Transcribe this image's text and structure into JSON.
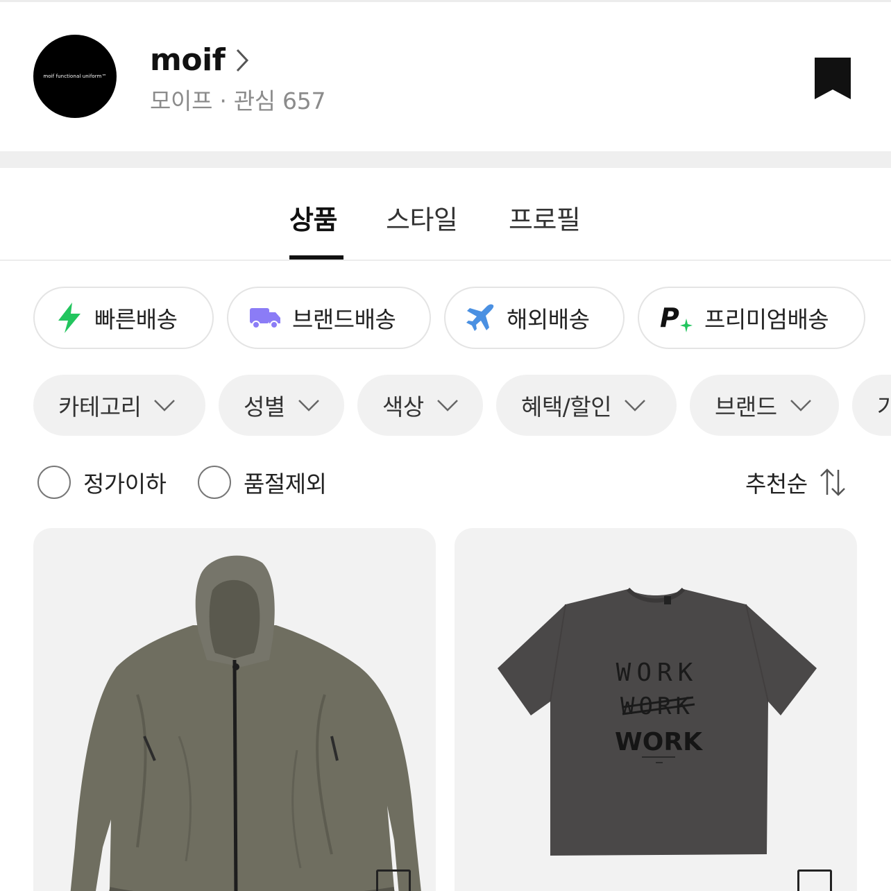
{
  "brand": {
    "logo_text": "moif functional uniform™",
    "name": "moif",
    "subtitle": "모이프 · 관심 657"
  },
  "tabs": [
    {
      "label": "상품",
      "active": true
    },
    {
      "label": "스타일",
      "active": false
    },
    {
      "label": "프로필",
      "active": false
    }
  ],
  "shipping_filters": [
    {
      "label": "빠른배송",
      "icon": "lightning-icon",
      "color": "#22c55e"
    },
    {
      "label": "브랜드배송",
      "icon": "truck-icon",
      "color": "#8b7cf6"
    },
    {
      "label": "해외배송",
      "icon": "airplane-icon",
      "color": "#4a90e2"
    },
    {
      "label": "프리미엄배송",
      "icon": "premium-p-icon",
      "color": "#22c55e"
    }
  ],
  "filters": [
    {
      "label": "카테고리"
    },
    {
      "label": "성별"
    },
    {
      "label": "색상"
    },
    {
      "label": "혜택/할인"
    },
    {
      "label": "브랜드"
    },
    {
      "label": "가"
    }
  ],
  "options": {
    "below_retail": "정가이하",
    "exclude_sold_out": "품절제외",
    "sort": "추천순"
  },
  "products": [
    {
      "image": "olive hooded zip-up windbreaker jacket",
      "color": "#6f6e60"
    },
    {
      "image": "charcoal short sleeve t-shirt with WORK print",
      "color": "#4a4848",
      "print_lines": [
        "WORK",
        "WORK",
        "WORK"
      ]
    }
  ]
}
